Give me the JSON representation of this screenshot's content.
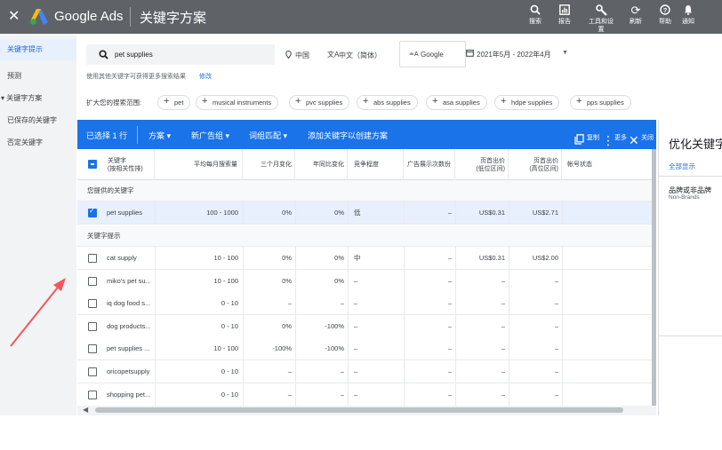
{
  "topbar": {
    "close_icon": "close-icon",
    "brand": "Google Ads",
    "page_title": "关键字方案",
    "buttons": [
      {
        "label": "搜索",
        "icon": "search-icon"
      },
      {
        "label": "报告",
        "icon": "chart-icon"
      },
      {
        "label": "工具和设置",
        "icon": "wrench-icon"
      },
      {
        "label": "刷新",
        "icon": "refresh-icon"
      },
      {
        "label": "帮助",
        "icon": "help-icon"
      },
      {
        "label": "通知",
        "icon": "bell-icon"
      }
    ],
    "bg_color": "#5f6368"
  },
  "sidebar": {
    "items": [
      {
        "label": "关键字提示",
        "active": true
      },
      {
        "label": "预测"
      },
      {
        "label": "▾ 关键字方案"
      },
      {
        "label": "已保存的关键字"
      },
      {
        "label": "否定关键字"
      }
    ]
  },
  "search": {
    "value": "pet supplies",
    "location": "中国",
    "language": "中文（简体）",
    "network": "Google",
    "date_range": "2021年5月 - 2022年4月",
    "hint": "使用其他关键字可获得更多搜索结果",
    "hint_link": "修改"
  },
  "broaden": {
    "label": "扩大您的搜索范围:",
    "chips": [
      "pet",
      "musical instruments",
      "pvc supplies",
      "abs supplies",
      "asa supplies",
      "hdpe supplies",
      "pps supplies"
    ]
  },
  "actionbar": {
    "selected": "已选择 1 行",
    "plan": "方案",
    "new_group": "新广告组",
    "match": "词组匹配",
    "add_link": "添加关键字以创建方案",
    "copy": "复制",
    "more": "更多",
    "close": "关闭",
    "accent": "#1a73e8"
  },
  "table": {
    "headers": {
      "keyword": "关键字",
      "keyword_sub": "(按相关性排)",
      "avg": "平均每月搜索量",
      "three_month": "三个月变化",
      "yoy": "年同比变化",
      "competition": "竞争程度",
      "impr_share": "广告展示次数份",
      "bid_low": "页首出价",
      "bid_low_sub": "(低位区间)",
      "bid_high": "页首出价",
      "bid_high_sub": "(高位区间)",
      "status": "帐号状态"
    },
    "section_provided": "您提供的关键字",
    "provided_rows": [
      {
        "kw": "pet supplies",
        "avg": "100 - 1000",
        "m3": "0%",
        "yoy": "0%",
        "comp": "低",
        "impr": "–",
        "low": "US$0.31",
        "high": "US$2.71"
      }
    ],
    "section_ideas": "关键字提示",
    "idea_rows": [
      {
        "kw": "cat supply",
        "avg": "10 - 100",
        "m3": "0%",
        "yoy": "0%",
        "comp": "中",
        "impr": "–",
        "low": "US$0.31",
        "high": "US$2.00"
      },
      {
        "kw": "miko's pet su...",
        "avg": "10 - 100",
        "m3": "0%",
        "yoy": "0%",
        "comp": "–",
        "impr": "–",
        "low": "–",
        "high": "–"
      },
      {
        "kw": "iq dog food s...",
        "avg": "0 - 10",
        "m3": "–",
        "yoy": "–",
        "comp": "–",
        "impr": "–",
        "low": "–",
        "high": "–"
      },
      {
        "kw": "dog products...",
        "avg": "0 - 10",
        "m3": "0%",
        "yoy": "-100%",
        "comp": "–",
        "impr": "–",
        "low": "–",
        "high": "–"
      },
      {
        "kw": "pet supplies ...",
        "avg": "10 - 100",
        "m3": "-100%",
        "yoy": "-100%",
        "comp": "–",
        "impr": "–",
        "low": "–",
        "high": "–"
      },
      {
        "kw": "oricopetsupply",
        "avg": "0 - 10",
        "m3": "–",
        "yoy": "–",
        "comp": "–",
        "impr": "–",
        "low": "–",
        "high": "–"
      },
      {
        "kw": "shopping pet...",
        "avg": "0 - 10",
        "m3": "–",
        "yoy": "–",
        "comp": "–",
        "impr": "–",
        "low": "–",
        "high": "–"
      }
    ]
  },
  "panel": {
    "title": "优化关键字",
    "show_all": "全部显示",
    "brand_title": "品牌或非品牌",
    "brand_sub": "Non-Brands"
  },
  "annotation": {
    "arrow_color": "#f0585b"
  }
}
